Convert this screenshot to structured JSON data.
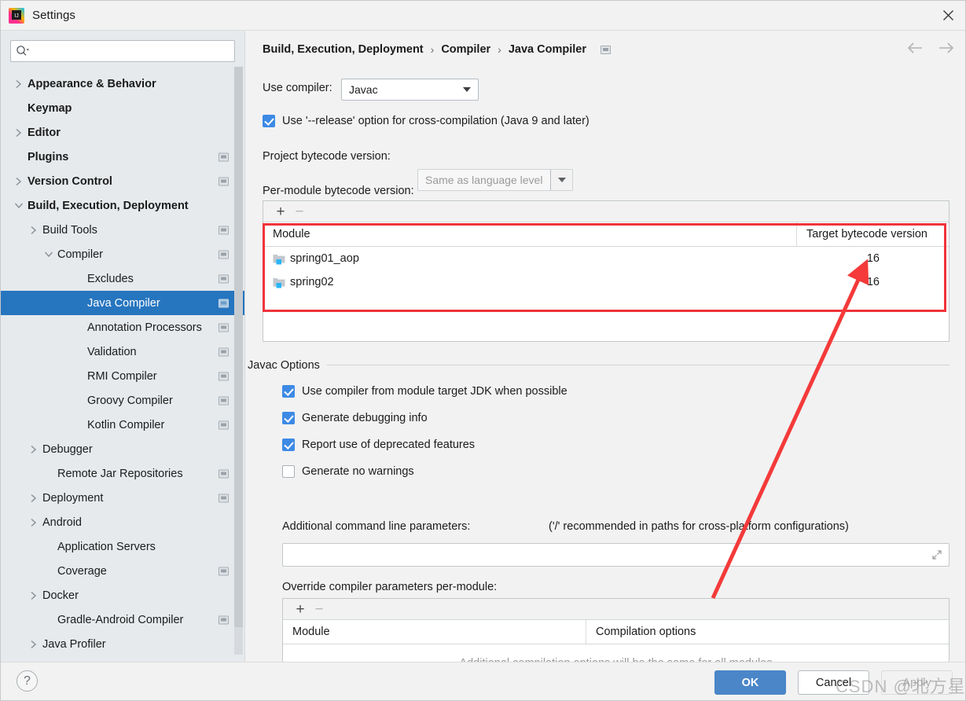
{
  "window": {
    "title": "Settings",
    "app_icon": "intellij-idea-logo",
    "close_icon": "close-icon"
  },
  "sidebar": {
    "search": {
      "placeholder": "",
      "value": "",
      "icon": "search-icon"
    },
    "items": [
      {
        "label": "Appearance & Behavior",
        "indent": 0,
        "arrow": "right",
        "bold": true,
        "badge": false,
        "selected": false
      },
      {
        "label": "Keymap",
        "indent": 0,
        "arrow": "none",
        "bold": true,
        "badge": false,
        "selected": false
      },
      {
        "label": "Editor",
        "indent": 0,
        "arrow": "right",
        "bold": true,
        "badge": false,
        "selected": false
      },
      {
        "label": "Plugins",
        "indent": 0,
        "arrow": "none",
        "bold": true,
        "badge": true,
        "selected": false
      },
      {
        "label": "Version Control",
        "indent": 0,
        "arrow": "right",
        "bold": true,
        "badge": true,
        "selected": false
      },
      {
        "label": "Build, Execution, Deployment",
        "indent": 0,
        "arrow": "down",
        "bold": true,
        "badge": false,
        "selected": false
      },
      {
        "label": "Build Tools",
        "indent": 1,
        "arrow": "right",
        "bold": false,
        "badge": true,
        "selected": false
      },
      {
        "label": "Compiler",
        "indent": 2,
        "arrow": "down",
        "bold": false,
        "badge": true,
        "selected": false
      },
      {
        "label": "Excludes",
        "indent": 4,
        "arrow": "none",
        "bold": false,
        "badge": true,
        "selected": false
      },
      {
        "label": "Java Compiler",
        "indent": 4,
        "arrow": "none",
        "bold": false,
        "badge": true,
        "selected": true
      },
      {
        "label": "Annotation Processors",
        "indent": 4,
        "arrow": "none",
        "bold": false,
        "badge": true,
        "selected": false
      },
      {
        "label": "Validation",
        "indent": 4,
        "arrow": "none",
        "bold": false,
        "badge": true,
        "selected": false
      },
      {
        "label": "RMI Compiler",
        "indent": 4,
        "arrow": "none",
        "bold": false,
        "badge": true,
        "selected": false
      },
      {
        "label": "Groovy Compiler",
        "indent": 4,
        "arrow": "none",
        "bold": false,
        "badge": true,
        "selected": false
      },
      {
        "label": "Kotlin Compiler",
        "indent": 4,
        "arrow": "none",
        "bold": false,
        "badge": true,
        "selected": false
      },
      {
        "label": "Debugger",
        "indent": 1,
        "arrow": "right",
        "bold": false,
        "badge": false,
        "selected": false
      },
      {
        "label": "Remote Jar Repositories",
        "indent": 2,
        "arrow": "none",
        "bold": false,
        "badge": true,
        "selected": false
      },
      {
        "label": "Deployment",
        "indent": 1,
        "arrow": "right",
        "bold": false,
        "badge": true,
        "selected": false
      },
      {
        "label": "Android",
        "indent": 1,
        "arrow": "right",
        "bold": false,
        "badge": false,
        "selected": false
      },
      {
        "label": "Application Servers",
        "indent": 2,
        "arrow": "none",
        "bold": false,
        "badge": false,
        "selected": false
      },
      {
        "label": "Coverage",
        "indent": 2,
        "arrow": "none",
        "bold": false,
        "badge": true,
        "selected": false
      },
      {
        "label": "Docker",
        "indent": 1,
        "arrow": "right",
        "bold": false,
        "badge": false,
        "selected": false
      },
      {
        "label": "Gradle-Android Compiler",
        "indent": 2,
        "arrow": "none",
        "bold": false,
        "badge": true,
        "selected": false
      },
      {
        "label": "Java Profiler",
        "indent": 1,
        "arrow": "right",
        "bold": false,
        "badge": false,
        "selected": false
      }
    ]
  },
  "main": {
    "breadcrumb": {
      "parts": [
        "Build, Execution, Deployment",
        "Compiler",
        "Java Compiler"
      ],
      "separator": "›",
      "badge_icon": "settings-sync-badge-icon"
    },
    "nav": {
      "back_icon": "arrow-left-icon",
      "forward_icon": "arrow-right-icon"
    },
    "use_compiler": {
      "label": "Use compiler:",
      "value": "Javac",
      "dropdown_icon": "chevron-down-icon"
    },
    "release_option": {
      "label": "Use '--release' option for cross-compilation (Java 9 and later)",
      "checked": true
    },
    "project_bytecode": {
      "label": "Project bytecode version:",
      "value": "Same as language level",
      "disabled": true,
      "dropdown_icon": "chevron-down-icon"
    },
    "per_module": {
      "label": "Per-module bytecode version:",
      "add_icon": "+",
      "remove_icon": "−",
      "columns": [
        "Module",
        "Target bytecode version"
      ],
      "rows": [
        {
          "module": "spring01_aop",
          "version": "16",
          "icon": "module-icon"
        },
        {
          "module": "spring02",
          "version": "16",
          "icon": "module-icon"
        }
      ]
    },
    "javac_options": {
      "title": "Javac Options",
      "checkboxes": [
        {
          "label": "Use compiler from module target JDK when possible",
          "checked": true
        },
        {
          "label": "Generate debugging info",
          "checked": true
        },
        {
          "label": "Report use of deprecated features",
          "checked": true
        },
        {
          "label": "Generate no warnings",
          "checked": false
        }
      ],
      "additional_params": {
        "label": "Additional command line parameters:",
        "hint": "('/' recommended in paths for cross-platform configurations)",
        "value": "",
        "expand_icon": "expand-icon"
      },
      "override": {
        "label": "Override compiler parameters per-module:",
        "add_icon": "+",
        "remove_icon": "−",
        "columns": [
          "Module",
          "Compilation options"
        ],
        "empty_message": "Additional compilation options will be the same for all modules"
      }
    }
  },
  "footer": {
    "help_label": "?",
    "ok_label": "OK",
    "cancel_label": "Cancel",
    "apply_label": "Apply",
    "apply_disabled": true
  },
  "annotations": {
    "highlight_color": "#f0333a",
    "arrow_color": "#f43a3a",
    "watermark": "CSDN @北方星河"
  }
}
